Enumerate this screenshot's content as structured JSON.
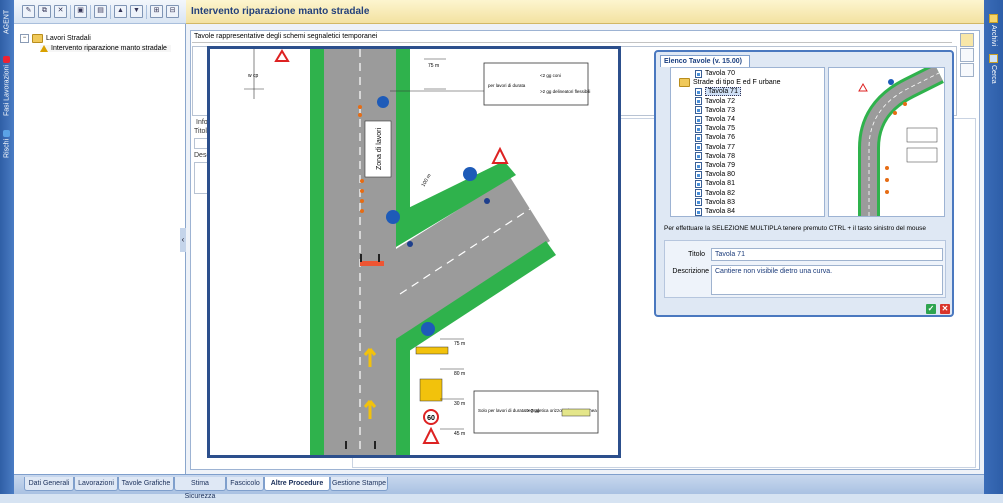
{
  "left_bar": {
    "tabs": [
      "AGENT",
      "Fasi Lavorazioni",
      "Rischi"
    ]
  },
  "right_bar": {
    "tabs": [
      "Archivi",
      "Cerca"
    ]
  },
  "tree": {
    "root_label": "Lavori Stradali",
    "child_label": "Intervento riparazione manto stradale"
  },
  "header": {
    "title": "Intervento riparazione manto stradale"
  },
  "field_label": "Tavole rappresentative degli schemi segnaletici temporanei",
  "ghost_labels": {
    "info": "Info",
    "titolo": "Titolo",
    "descrizione": "Descr"
  },
  "drawing": {
    "texts": {
      "lavori_durata": "per lavori di durata",
      "gg_coni": "<2 gg coni",
      "gg_delin": ">2 gg delineatori flessibili",
      "zona": "Zona di lavori",
      "solo_lavori": "Solo per lavori di durata > 7 gg",
      "segnaletica": "Segnaletica orizzontale temporanea",
      "d75": "75 m",
      "d80": "80 m",
      "d30": "30 m",
      "d45": "45 m",
      "d100": "100 m",
      "s60": "60",
      "wcp": "w cp"
    }
  },
  "dialog": {
    "tab_label": "Elenco Tavole (v. 15.00)",
    "list": [
      {
        "label": "Tavola 70",
        "kind": "doc",
        "indent": 2
      },
      {
        "label": "Strade di tipo E ed F urbane",
        "kind": "folder",
        "indent": 1
      },
      {
        "label": "Tavola 71",
        "kind": "doc",
        "indent": 2,
        "selected": true
      },
      {
        "label": "Tavola 72",
        "kind": "doc",
        "indent": 2
      },
      {
        "label": "Tavola 73",
        "kind": "doc",
        "indent": 2
      },
      {
        "label": "Tavola 74",
        "kind": "doc",
        "indent": 2
      },
      {
        "label": "Tavola 75",
        "kind": "doc",
        "indent": 2
      },
      {
        "label": "Tavola 76",
        "kind": "doc",
        "indent": 2
      },
      {
        "label": "Tavola 77",
        "kind": "doc",
        "indent": 2
      },
      {
        "label": "Tavola 78",
        "kind": "doc",
        "indent": 2
      },
      {
        "label": "Tavola 79",
        "kind": "doc",
        "indent": 2
      },
      {
        "label": "Tavola 80",
        "kind": "doc",
        "indent": 2
      },
      {
        "label": "Tavola 81",
        "kind": "doc",
        "indent": 2
      },
      {
        "label": "Tavola 82",
        "kind": "doc",
        "indent": 2
      },
      {
        "label": "Tavola 83",
        "kind": "doc",
        "indent": 2
      },
      {
        "label": "Tavola 84",
        "kind": "doc",
        "indent": 2
      }
    ],
    "hint": "Per effettuare la SELEZIONE MULTIPLA tenere premuto  CTRL  + il tasto sinistro del mouse",
    "titolo_label": "Titolo",
    "titolo_value": "Tavola 71",
    "descrizione_label": "Descrizione",
    "descrizione_value": "Cantiere non visibile dietro una curva.",
    "ok_color": "#2ea44f",
    "cancel_color": "#d9342b"
  },
  "bottom_tabs": [
    {
      "label": "Dati Generali"
    },
    {
      "label": "Lavorazioni"
    },
    {
      "label": "Tavole Grafiche"
    },
    {
      "label": "Stima Sicurezza"
    },
    {
      "label": "Fascicolo"
    },
    {
      "label": "Altre Procedure",
      "active": true
    },
    {
      "label": "Gestione Stampe"
    }
  ]
}
